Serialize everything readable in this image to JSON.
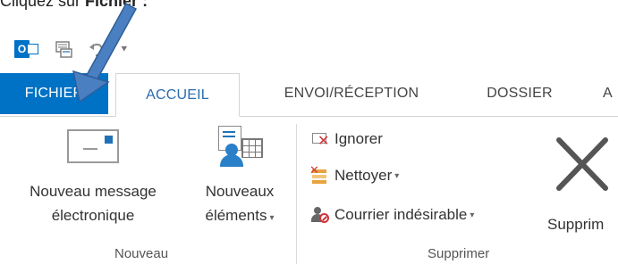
{
  "instruction": {
    "prefix": "Cliquez sur ",
    "bold": "Fichier :"
  },
  "quick_access": {
    "icons": [
      "outlook-logo-icon",
      "send-receive-icon",
      "undo-icon",
      "customize-dropdown-icon"
    ],
    "dropdown_glyph": "⯆"
  },
  "tabs": {
    "file": "FICHIER",
    "home": "ACCUEIL",
    "send_receive": "ENVOI/RÉCEPTION",
    "folder": "DOSSIER",
    "more": "A"
  },
  "ribbon": {
    "new_group": {
      "label": "Nouveau",
      "new_email_line1": "Nouveau message",
      "new_email_line2": "électronique",
      "new_items_line1": "Nouveaux",
      "new_items_line2": "éléments"
    },
    "delete_group": {
      "label": "Supprimer",
      "ignore": "Ignorer",
      "clean_up": "Nettoyer",
      "junk": "Courrier indésirable",
      "delete": "Supprim"
    }
  },
  "colors": {
    "file_tab": "#0072c6",
    "active_tab_text": "#2b6cb0",
    "arrow": "#4a7fc1"
  }
}
